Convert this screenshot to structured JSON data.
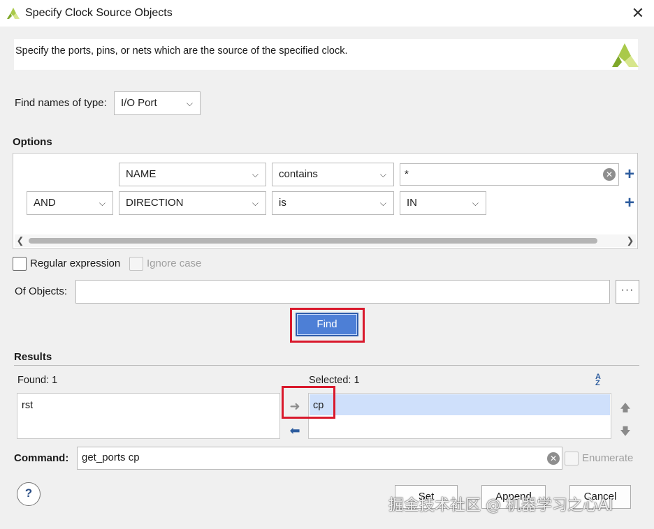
{
  "window": {
    "title": "Specify Clock Source Objects",
    "close_label": "✕"
  },
  "banner": {
    "description": "Specify the ports, pins, or nets which are the source of the specified clock."
  },
  "find_type": {
    "label": "Find names of type:",
    "value": "I/O Port"
  },
  "options": {
    "heading": "Options",
    "row1": {
      "property": "NAME",
      "operator": "contains",
      "value": "*"
    },
    "row2": {
      "logic": "AND",
      "property": "DIRECTION",
      "operator": "is",
      "value": "IN"
    }
  },
  "regex": {
    "label": "Regular expression",
    "ignore_case_label": "Ignore case"
  },
  "of_objects": {
    "label": "Of Objects:",
    "value": "",
    "browse_label": "···"
  },
  "find_button": {
    "label": "Find"
  },
  "results": {
    "heading": "Results",
    "found_label": "Found: 1",
    "found_items": [
      "rst"
    ],
    "selected_label": "Selected: 1",
    "selected_items": [
      "cp"
    ]
  },
  "command": {
    "label": "Command:",
    "value": "get_ports cp",
    "enumerate_label": "Enumerate"
  },
  "buttons": {
    "help": "?",
    "set": "Set",
    "append": "Append",
    "cancel": "Cancel"
  },
  "watermark": "掘金技术社区 @ 机器学习之心AI",
  "colors": {
    "accent": "#4d7fd6",
    "highlight_border": "#d9192c",
    "selection": "#cfe0fb",
    "plus": "#2d5c9e"
  }
}
